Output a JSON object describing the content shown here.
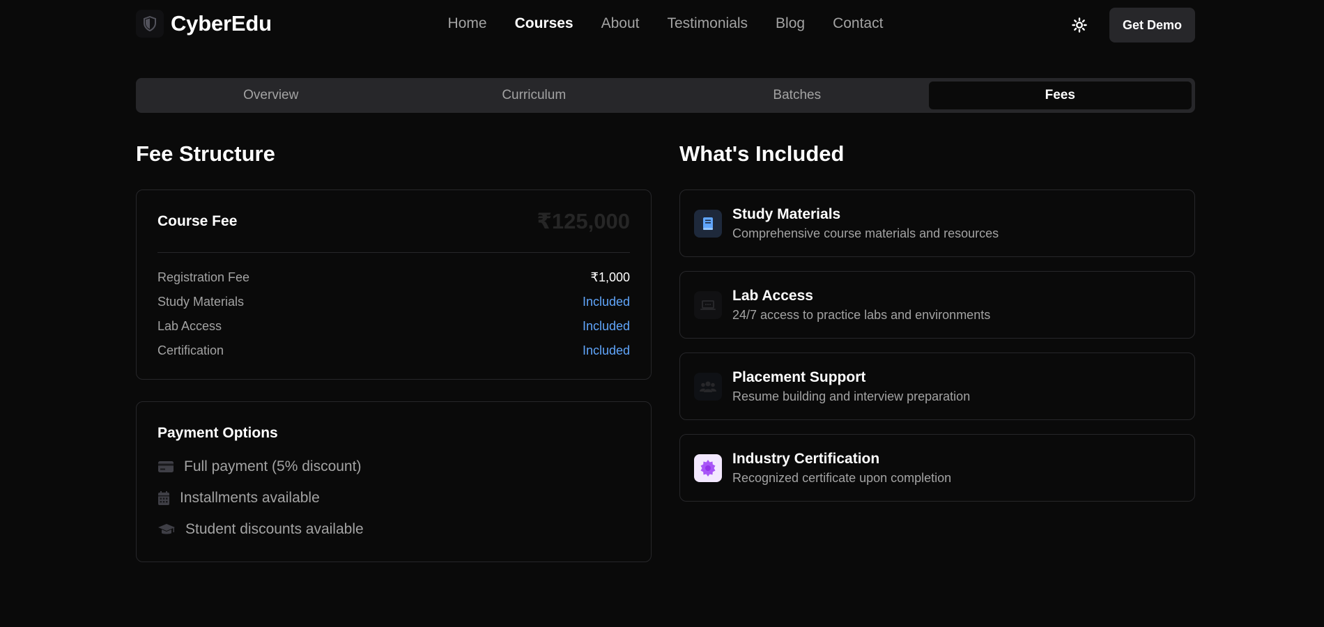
{
  "brand": {
    "name": "CyberEdu",
    "icon": "shield-icon"
  },
  "nav": {
    "items": [
      "Home",
      "Courses",
      "About",
      "Testimonials",
      "Blog",
      "Contact"
    ],
    "active": "Courses"
  },
  "header": {
    "theme_icon": "sun-icon",
    "demo_label": "Get Demo"
  },
  "tabs": {
    "items": [
      "Overview",
      "Curriculum",
      "Batches",
      "Fees"
    ],
    "active": "Fees"
  },
  "fees": {
    "heading": "Fee Structure",
    "course_fee_label": "Course Fee",
    "course_fee_amount": "₹125,000",
    "rows": [
      {
        "label": "Registration Fee",
        "value": "₹1,000"
      },
      {
        "label": "Study Materials",
        "value": "Included"
      },
      {
        "label": "Lab Access",
        "value": "Included"
      },
      {
        "label": "Certification",
        "value": "Included"
      }
    ]
  },
  "payment": {
    "title": "Payment Options",
    "items": [
      {
        "icon": "credit-card-icon",
        "label": "Full payment (5% discount)"
      },
      {
        "icon": "calendar-icon",
        "label": "Installments available"
      },
      {
        "icon": "graduation-cap-icon",
        "label": "Student discounts available"
      }
    ]
  },
  "included": {
    "heading": "What's Included",
    "items": [
      {
        "icon": "book-icon",
        "title": "Study Materials",
        "desc": "Comprehensive course materials and resources"
      },
      {
        "icon": "laptop-icon",
        "title": "Lab Access",
        "desc": "24/7 access to practice labs and environments"
      },
      {
        "icon": "users-icon",
        "title": "Placement Support",
        "desc": "Resume building and interview preparation"
      },
      {
        "icon": "certificate-icon",
        "title": "Industry Certification",
        "desc": "Recognized certificate upon completion"
      }
    ]
  },
  "colors": {
    "accent": "#60a5fa",
    "background": "#0a0a0a",
    "border": "#27272a",
    "badge_purple": "#a855f7"
  }
}
